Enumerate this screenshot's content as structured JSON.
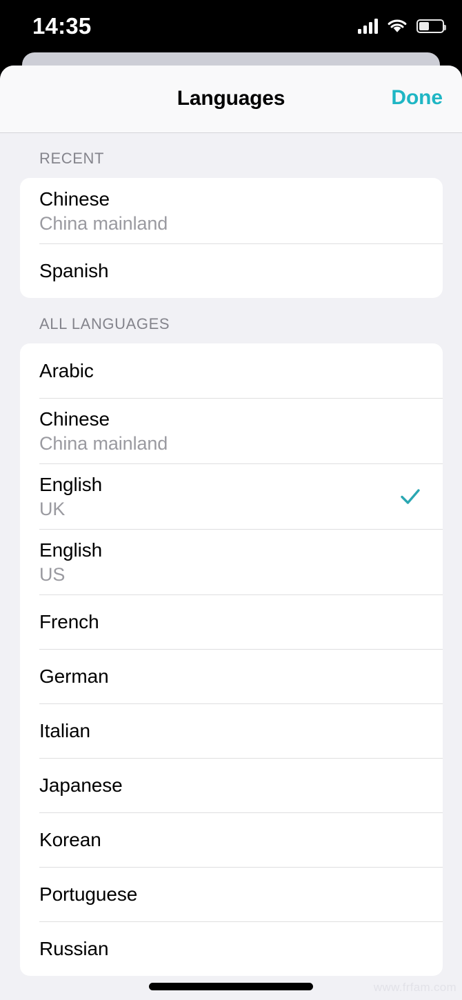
{
  "status_bar": {
    "time": "14:35",
    "cellular_icon": "cellular-bars-icon",
    "wifi_icon": "wifi-icon",
    "battery_icon": "battery-icon",
    "battery_level_percent": 40
  },
  "navbar": {
    "title": "Languages",
    "done_label": "Done",
    "accent_color": "#1fb6c4"
  },
  "sections": [
    {
      "header": "RECENT",
      "rows": [
        {
          "title": "Chinese",
          "subtitle": "China mainland",
          "selected": false
        },
        {
          "title": "Spanish",
          "subtitle": "",
          "selected": false
        }
      ]
    },
    {
      "header": "ALL LANGUAGES",
      "rows": [
        {
          "title": "Arabic",
          "subtitle": "",
          "selected": false
        },
        {
          "title": "Chinese",
          "subtitle": "China mainland",
          "selected": false
        },
        {
          "title": "English",
          "subtitle": "UK",
          "selected": true
        },
        {
          "title": "English",
          "subtitle": "US",
          "selected": false
        },
        {
          "title": "French",
          "subtitle": "",
          "selected": false
        },
        {
          "title": "German",
          "subtitle": "",
          "selected": false
        },
        {
          "title": "Italian",
          "subtitle": "",
          "selected": false
        },
        {
          "title": "Japanese",
          "subtitle": "",
          "selected": false
        },
        {
          "title": "Korean",
          "subtitle": "",
          "selected": false
        },
        {
          "title": "Portuguese",
          "subtitle": "",
          "selected": false
        },
        {
          "title": "Russian",
          "subtitle": "",
          "selected": false
        }
      ]
    }
  ],
  "checkmark": {
    "icon": "checkmark-icon",
    "color": "#2aa7b2"
  },
  "watermark": {
    "text": "www.frfam.com"
  },
  "home_indicator": {
    "icon": "home-indicator"
  }
}
